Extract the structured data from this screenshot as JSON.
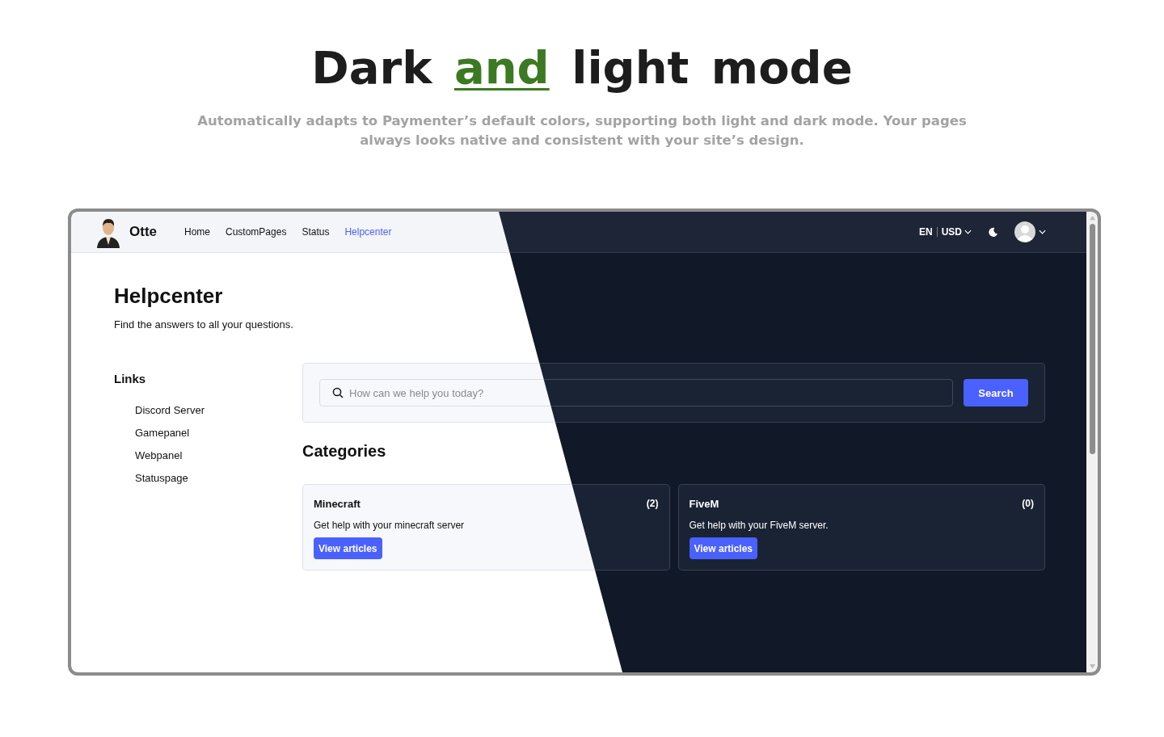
{
  "hero": {
    "title": "Dark **and** light mode",
    "subtitle": "Automatically adapts to Paymenter’s default colors, supporting both light and dark mode. Your pages always looks native and consistent with your site’s design."
  },
  "navbar": {
    "brand": "Otte",
    "links": [
      {
        "label": "Home",
        "selected": false
      },
      {
        "label": "CustomPages",
        "selected": false
      },
      {
        "label": "Status",
        "selected": false
      },
      {
        "label": "Helpcenter",
        "selected": true
      }
    ],
    "locale": "EN",
    "currency": "USD"
  },
  "page": {
    "title": "Helpcenter",
    "subtitle": "Find the answers to all your questions."
  },
  "links": {
    "heading": "Links",
    "items": [
      "Discord Server",
      "Gamepanel",
      "Webpanel",
      "Statuspage"
    ]
  },
  "search": {
    "placeholder": "How can we help you today?",
    "button": "Search"
  },
  "categories": {
    "heading": "Categories",
    "items": [
      {
        "name": "Minecraft",
        "count": "(2)",
        "description": "Get help with your minecraft server",
        "button": "View articles"
      },
      {
        "name": "FiveM",
        "count": "(0)",
        "description": "Get help with your FiveM server.",
        "button": "View articles"
      }
    ]
  }
}
